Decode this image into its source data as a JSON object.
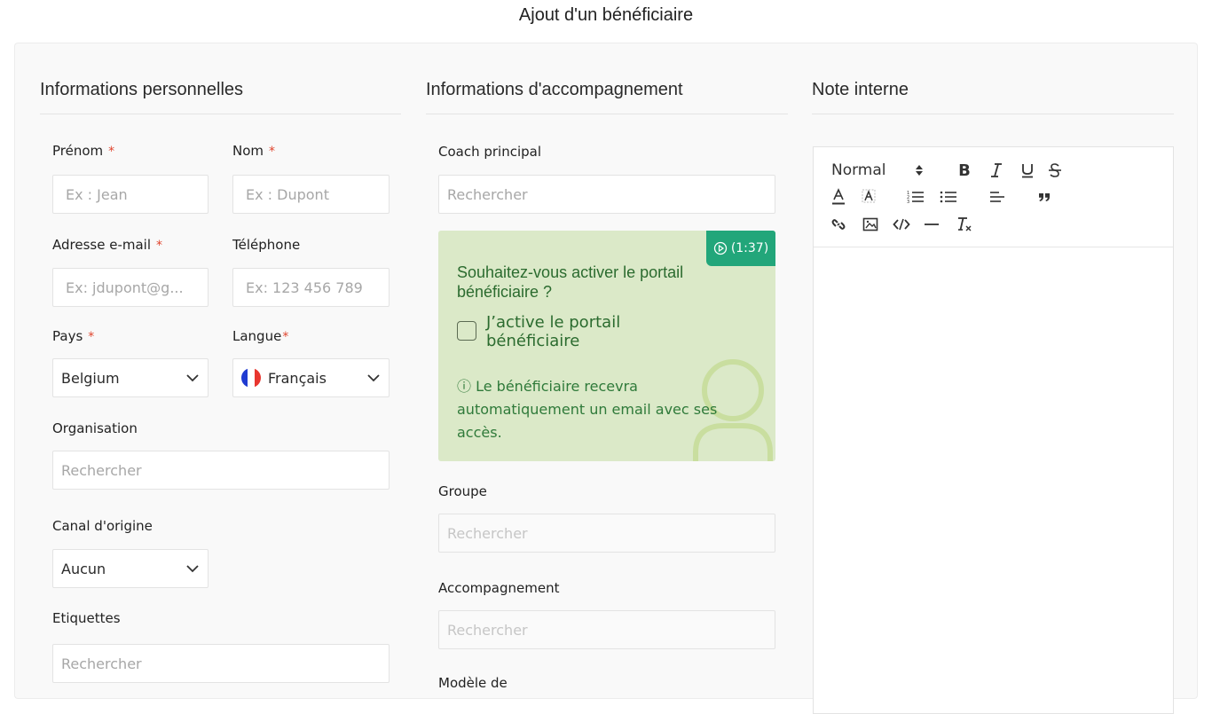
{
  "page": {
    "title": "Ajout d'un bénéficiaire"
  },
  "sections": {
    "personal": "Informations personnelles",
    "support": "Informations d'accompagnement",
    "note": "Note interne"
  },
  "personal": {
    "first_name": {
      "label": "Prénom",
      "required": "*",
      "placeholder": "Ex : Jean"
    },
    "last_name": {
      "label": "Nom",
      "required": "*",
      "placeholder": "Ex : Dupont"
    },
    "email": {
      "label": "Adresse e-mail",
      "required": "*",
      "placeholder": "Ex: jdupont@g..."
    },
    "phone": {
      "label": "Téléphone",
      "placeholder": "Ex: 123 456 789"
    },
    "country": {
      "label": "Pays",
      "required": "*",
      "value": "Belgium"
    },
    "language": {
      "label": "Langue",
      "required": "*",
      "value": "Français",
      "flag_icon": "france-flag-icon"
    },
    "organisation": {
      "label": "Organisation",
      "placeholder": "Rechercher"
    },
    "origin_channel": {
      "label": "Canal d'origine",
      "value": "Aucun"
    },
    "tags": {
      "label": "Etiquettes",
      "placeholder": "Rechercher"
    }
  },
  "support": {
    "main_coach": {
      "label": "Coach principal",
      "placeholder": "Rechercher"
    },
    "portal": {
      "video_badge": "(1:37)",
      "question": "Souhaitez-vous activer le portail bénéficiaire ?",
      "checkbox_label": "J’active le portail bénéficiaire",
      "info_icon": "ⓘ",
      "info": "Le bénéficiaire recevra automatiquement un email avec ses accès.",
      "bg_color": "#dbe9c8",
      "badge_color": "#22a67a"
    },
    "group": {
      "label": "Groupe",
      "placeholder": "Rechercher"
    },
    "accompaniment": {
      "label": "Accompagnement",
      "placeholder": "Rechercher"
    },
    "model": {
      "label": "Modèle de"
    }
  },
  "editor": {
    "format_select": "Normal",
    "tools": [
      "bold-icon",
      "italic-icon",
      "underline-icon",
      "strike-icon",
      "text-color-icon",
      "highlight-icon",
      "ordered-list-icon",
      "bullet-list-icon",
      "align-icon",
      "quote-icon",
      "link-icon",
      "image-icon",
      "code-icon",
      "hr-icon",
      "clear-format-icon"
    ]
  },
  "colors": {
    "required": "#e0452e",
    "accent": "#22a67a"
  }
}
